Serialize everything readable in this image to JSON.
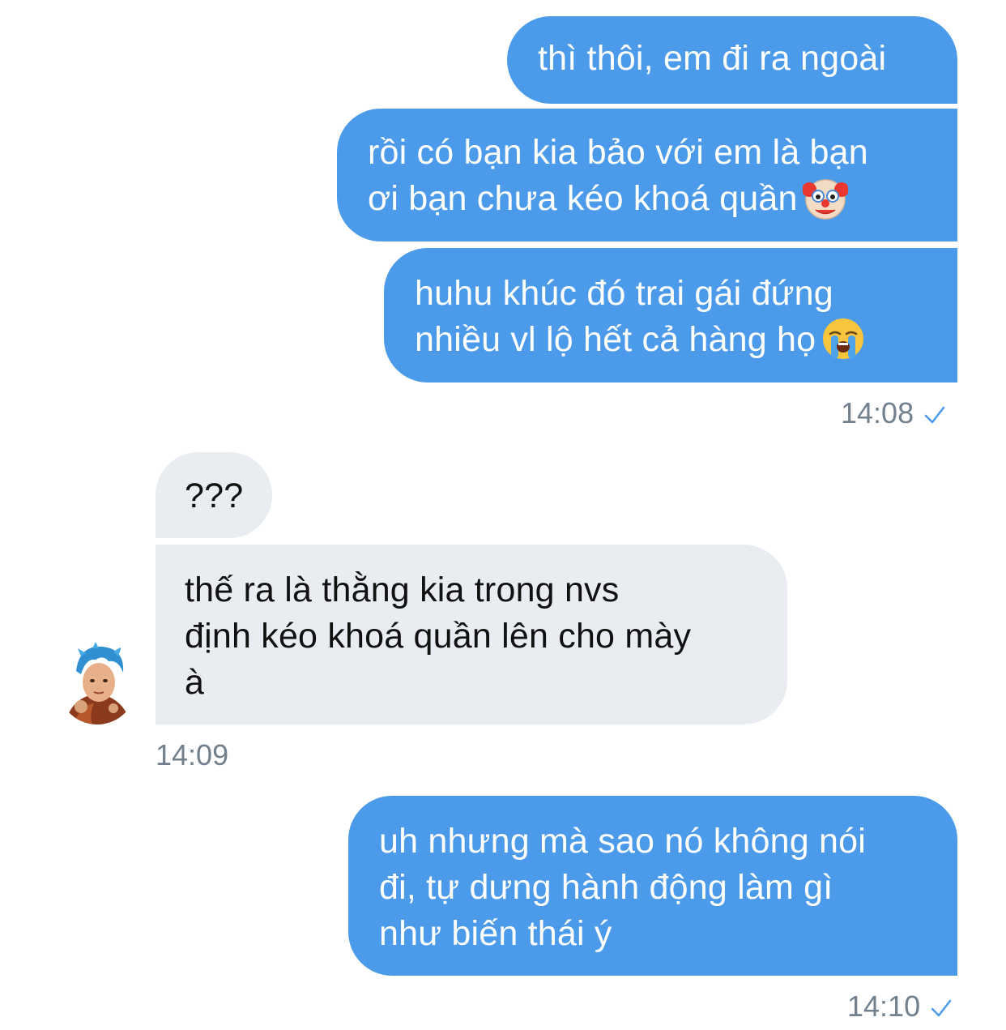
{
  "messages": [
    {
      "direction": "outgoing",
      "lines": [
        "thì thôi, em đi ra ngoài"
      ]
    },
    {
      "direction": "outgoing",
      "lines": [
        "rồi có bạn kia bảo với em là bạn",
        "ơi bạn chưa kéo khoá quần"
      ],
      "emoji": "clown-face"
    },
    {
      "direction": "outgoing",
      "lines": [
        "huhu khúc đó trai gái đứng",
        "nhiều vl lộ hết cả hàng họ"
      ],
      "emoji": "loudly-crying-face"
    },
    {
      "direction": "incoming",
      "lines": [
        "???"
      ]
    },
    {
      "direction": "incoming",
      "lines": [
        "thế ra là thằng kia trong nvs",
        "định kéo khoá quần lên cho mày",
        "à"
      ]
    },
    {
      "direction": "outgoing",
      "lines": [
        "uh nhưng mà sao nó không nói",
        "đi, tự dưng hành động làm gì",
        "như biến thái ý"
      ]
    }
  ],
  "timestamps": {
    "group1": "14:08",
    "group2": "14:09",
    "group3": "14:10"
  },
  "colors": {
    "outgoing_bubble": "#4c9bea",
    "incoming_bubble": "#e9ecf1",
    "timestamp_text": "#72808d",
    "read_check": "#4c9bea"
  },
  "icons": {
    "read_receipt": "checkmark-icon",
    "avatar": "contact-avatar"
  }
}
